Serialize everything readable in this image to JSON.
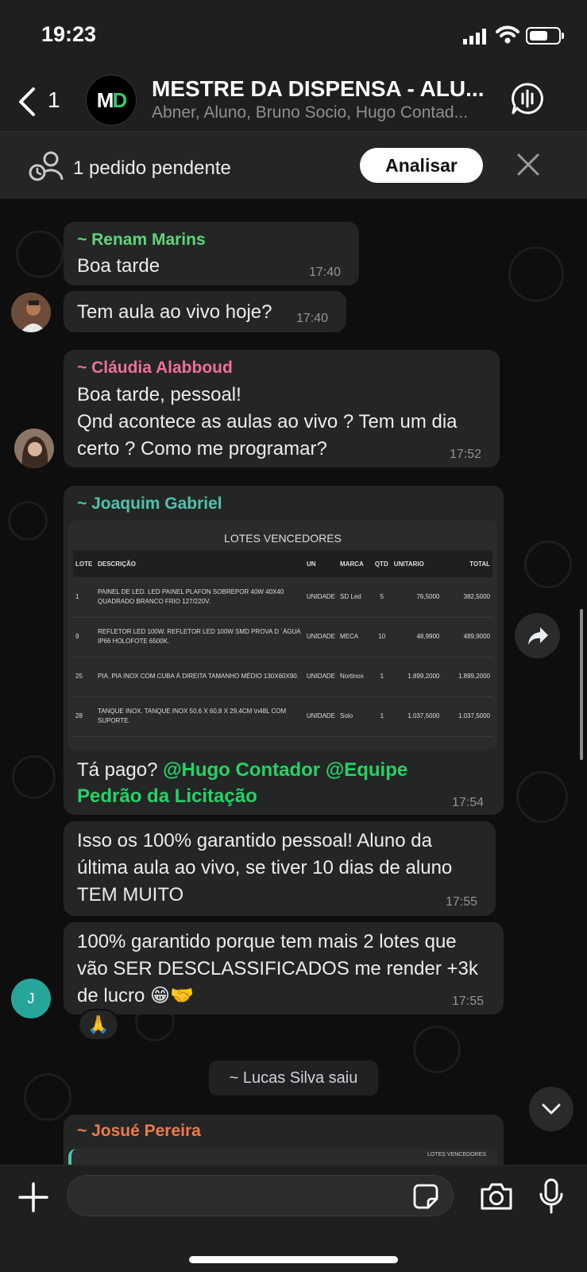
{
  "status_bar": {
    "time": "19:23"
  },
  "header": {
    "back_count": "1",
    "group_name": "MESTRE DA DISPENSA - ALU...",
    "members": "Abner, Aluno, Bruno Socio, Hugo Contad..."
  },
  "pending": {
    "text": "1 pedido pendente",
    "button": "Analisar"
  },
  "messages": {
    "m1": {
      "sender": "~ Renam Marins",
      "text": "Boa tarde",
      "time": "17:40"
    },
    "m2": {
      "text": "Tem aula ao vivo hoje?",
      "time": "17:40"
    },
    "m3": {
      "sender": "~ Cláudia Alabboud",
      "line1": "Boa tarde, pessoal!",
      "line2": "Qnd acontece as aulas ao vivo ? Tem um dia",
      "line3": "certo ? Como me programar?",
      "time": "17:52"
    },
    "m4": {
      "sender": "~ Joaquim Gabriel",
      "text_prefix": "Tá pago? ",
      "mention1": "@Hugo Contador",
      "text_mid": " ",
      "mention2": "@Equipe",
      "mention2b": "Pedrão da Licitação",
      "time": "17:54"
    },
    "m5": {
      "line1": "Isso os 100% garantido pessoal! Aluno da",
      "line2": "última aula ao vivo, se tiver 10 dias de aluno",
      "line3": "TEM MUITO",
      "time": "17:55"
    },
    "m6": {
      "line1": "100% garantido porque tem mais 2 lotes que",
      "line2": "vão SER DESCLASSIFICADOS me render +3k",
      "line3": "de lucro 😁🤝",
      "time": "17:55",
      "avatar_letter": "J",
      "reaction": "🙏"
    },
    "system": "~ Lucas Silva saiu",
    "m7": {
      "sender": "~ Josué Pereira",
      "preview_title": "LOTES VENCEDORES"
    }
  },
  "table": {
    "title": "LOTES VENCEDORES",
    "headers": [
      "LOTE",
      "DESCRIÇÃO",
      "UN",
      "MARCA",
      "QTD",
      "UNITARIO",
      "TOTAL"
    ],
    "rows": [
      [
        "1",
        "PAINEL DE LED. LED PAINEL PLAFON SOBREPOR 40W 40X40 QUADRADO BRANCO FRIO 127/220V.",
        "UNIDADE",
        "SD Led",
        "5",
        "76,5000",
        "382,5000"
      ],
      [
        "9",
        "REFLETOR LED 100W. REFLETOR LED 100W SMD PROVA D ´ÁGUA IP66 HOLOFOTE 6500K.",
        "UNIDADE",
        "MECA",
        "10",
        "48,9900",
        "489,9000"
      ],
      [
        "25",
        "PIA. PIA INOX COM CUBA À DIREITA TAMANHO MÉDIO 130X60X90.",
        "UNIDADE",
        "Nortinox",
        "1",
        "1.899,2000",
        "1.899,2000"
      ],
      [
        "28",
        "TANQUE INOX. TANQUE INOX 50,6 X 60,8 X 29,4CM \\n48L COM SUPORTE.",
        "UNIDADE",
        "Solo",
        "1",
        "1.037,5000",
        "1.037,5000"
      ]
    ]
  },
  "colors": {
    "renam": "#5fd47a",
    "claudia": "#ef6f9a",
    "joaquim": "#4fc3ad",
    "josue": "#ef7a4a",
    "mention": "#25d366"
  }
}
